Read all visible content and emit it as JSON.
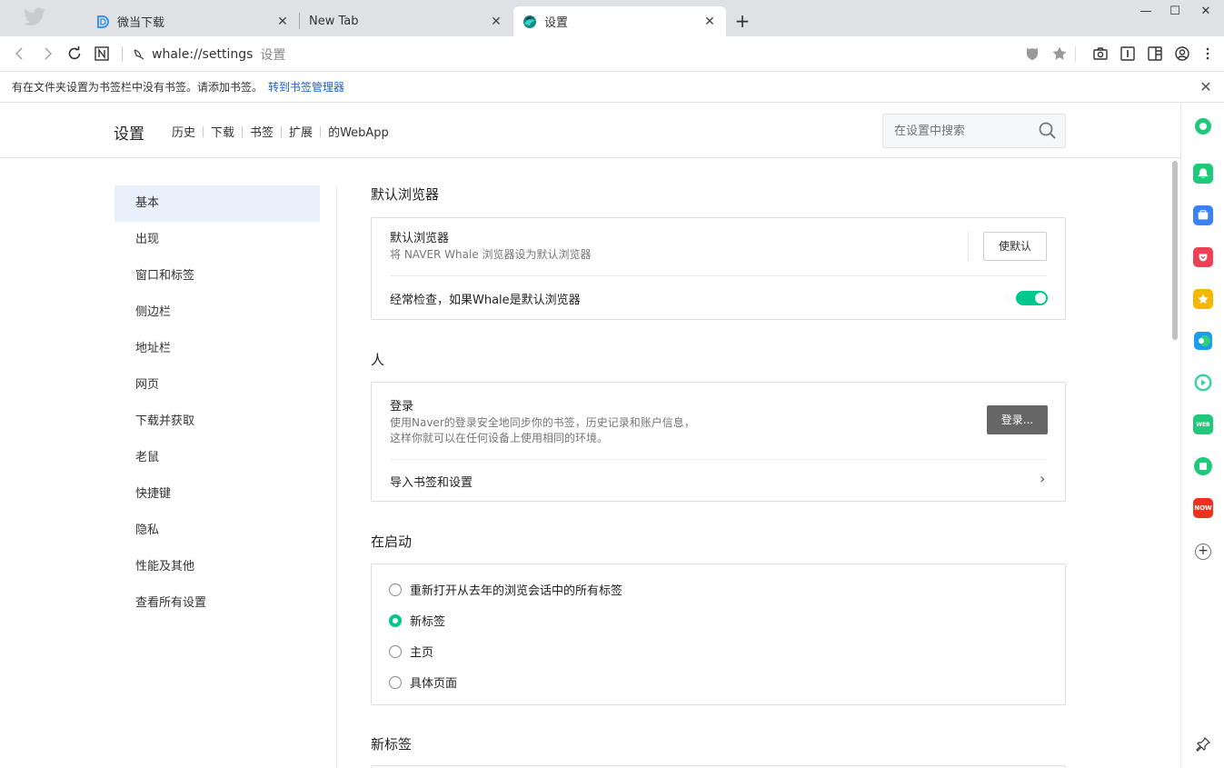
{
  "tabs": [
    {
      "title": "微当下载",
      "favicon": "weidown-d-icon",
      "active": false
    },
    {
      "title": "New Tab",
      "favicon": "none",
      "active": false
    },
    {
      "title": "设置",
      "favicon": "whale-icon",
      "active": true
    }
  ],
  "toolbar": {
    "url": "whale://settings",
    "url_label": "设置"
  },
  "infobar": {
    "message": "有在文件夹设置为书签栏中没有书签。请添加书签。",
    "link": "转到书签管理器"
  },
  "settings_header": {
    "title": "设置",
    "nav": [
      "历史",
      "下载",
      "书签",
      "扩展",
      "的WebApp"
    ],
    "search_placeholder": "在设置中搜索"
  },
  "left_nav": [
    {
      "label": "基本",
      "active": true
    },
    {
      "label": "出现",
      "active": false
    },
    {
      "label": "窗口和标签",
      "active": false
    },
    {
      "label": "侧边栏",
      "active": false
    },
    {
      "label": "地址栏",
      "active": false
    },
    {
      "label": "网页",
      "active": false
    },
    {
      "label": "下载并获取",
      "active": false
    },
    {
      "label": "老鼠",
      "active": false
    },
    {
      "label": "快捷键",
      "active": false
    },
    {
      "label": "隐私",
      "active": false
    },
    {
      "label": "性能及其他",
      "active": false
    },
    {
      "label": "查看所有设置",
      "active": false
    }
  ],
  "sections": {
    "default_browser": {
      "title": "默认浏览器",
      "row_title": "默认浏览器",
      "row_desc": "将 NAVER Whale 浏览器设为默认浏览器",
      "button": "使默认",
      "check_label": "经常检查，如果Whale是默认浏览器",
      "check_enabled": true
    },
    "people": {
      "title": "人",
      "login_title": "登录",
      "login_desc_1": "使用Naver的登录安全地同步你的书签，历史记录和账户信息，",
      "login_desc_2": "这样你就可以在任何设备上使用相同的环境。",
      "login_button": "登录...",
      "import_label": "导入书签和设置"
    },
    "startup": {
      "title": "在启动",
      "options": [
        {
          "label": "重新打开从去年的浏览会话中的所有标签",
          "selected": false
        },
        {
          "label": "新标签",
          "selected": true
        },
        {
          "label": "主页",
          "selected": false
        },
        {
          "label": "具体页面",
          "selected": false
        }
      ]
    },
    "new_tab": {
      "title": "新标签"
    }
  },
  "colors": {
    "accent": "#00c88c",
    "link": "#1a62c7",
    "active_nav_bg": "#e8f1fb"
  }
}
